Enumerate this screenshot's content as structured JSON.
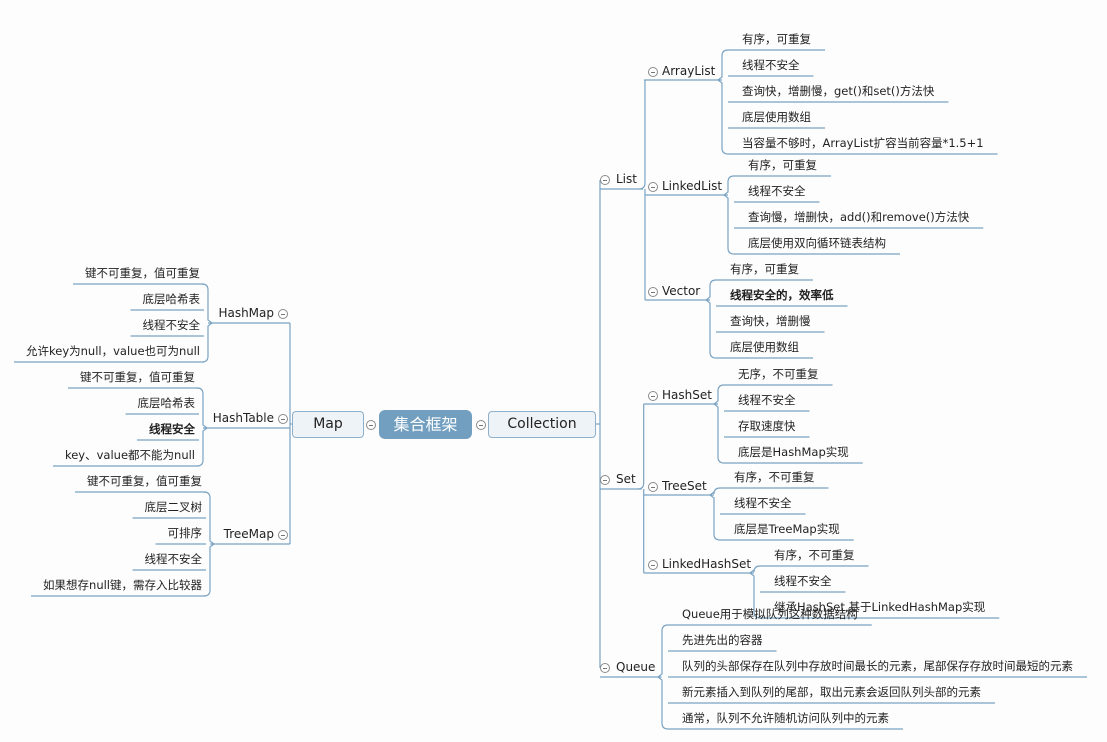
{
  "root": {
    "label": "集合框架"
  },
  "colors": {
    "root_fill": "#729fbf",
    "line": "#7aa3c2",
    "main_fill": "#eef3f7",
    "main_border": "#8fb0c8"
  },
  "right": {
    "label": "Collection",
    "children": [
      {
        "label": "List",
        "children": [
          {
            "label": "ArrayList",
            "items": [
              {
                "text": "有序，可重复"
              },
              {
                "text": "线程不安全"
              },
              {
                "text": "查询快，增删慢，get()和set()方法快"
              },
              {
                "text": "底层使用数组"
              },
              {
                "text": "当容量不够时，ArrayList扩容当前容量*1.5+1"
              }
            ]
          },
          {
            "label": "LinkedList",
            "items": [
              {
                "text": "有序，可重复"
              },
              {
                "text": "线程不安全"
              },
              {
                "text": "查询慢，增删快，add()和remove()方法快"
              },
              {
                "text": "底层使用双向循环链表结构"
              }
            ]
          },
          {
            "label": "Vector",
            "items": [
              {
                "text": "有序，可重复"
              },
              {
                "text": "线程安全的，效率低",
                "bold": true
              },
              {
                "text": "查询快，增删慢"
              },
              {
                "text": "底层使用数组"
              }
            ]
          }
        ]
      },
      {
        "label": "Set",
        "children": [
          {
            "label": "HashSet",
            "items": [
              {
                "text": "无序，不可重复"
              },
              {
                "text": "线程不安全"
              },
              {
                "text": "存取速度快"
              },
              {
                "text": "底层是HashMap实现"
              }
            ]
          },
          {
            "label": "TreeSet",
            "items": [
              {
                "text": "有序，不可重复"
              },
              {
                "text": "线程不安全"
              },
              {
                "text": "底层是TreeMap实现"
              }
            ]
          },
          {
            "label": "LinkedHashSet",
            "items": [
              {
                "text": "有序，不可重复"
              },
              {
                "text": "线程不安全"
              },
              {
                "text": "继承HashSet,基于LinkedHashMap实现"
              }
            ]
          }
        ]
      },
      {
        "label": "Queue",
        "items": [
          {
            "text": "Queue用于模拟队列这种数据结构"
          },
          {
            "text": "先进先出的容器"
          },
          {
            "text": "队列的头部保存在队列中存放时间最长的元素，尾部保存存放时间最短的元素"
          },
          {
            "text": "新元素插入到队列的尾部，取出元素会返回队列头部的元素"
          },
          {
            "text": "通常，队列不允许随机访问队列中的元素"
          }
        ]
      }
    ]
  },
  "left": {
    "label": "Map",
    "children": [
      {
        "label": "HashMap",
        "items": [
          {
            "text": "键不可重复，值可重复"
          },
          {
            "text": "底层哈希表"
          },
          {
            "text": "线程不安全"
          },
          {
            "text": "允许key为null，value也可为null"
          }
        ]
      },
      {
        "label": "HashTable",
        "items": [
          {
            "text": "键不可重复，值可重复"
          },
          {
            "text": "底层哈希表"
          },
          {
            "text": "线程安全",
            "bold": true
          },
          {
            "text": "key、value都不能为null"
          }
        ]
      },
      {
        "label": "TreeMap",
        "items": [
          {
            "text": "键不可重复，值可重复"
          },
          {
            "text": "底层二叉树"
          },
          {
            "text": "可排序"
          },
          {
            "text": "线程不安全"
          },
          {
            "text": "如果想存null键，需存入比较器"
          }
        ]
      }
    ]
  }
}
